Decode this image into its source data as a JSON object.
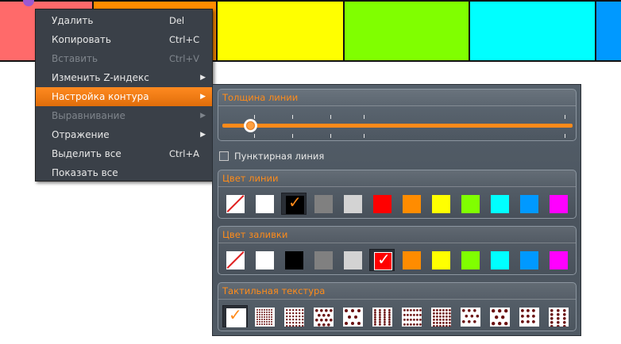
{
  "canvas": {
    "blocks": [
      {
        "color": "#ff6a6a"
      },
      {
        "color": "#ff8c00"
      },
      {
        "color": "#ffff00"
      },
      {
        "color": "#80ff00"
      },
      {
        "color": "#00ffff"
      },
      {
        "color": "#0099ff"
      }
    ]
  },
  "menu": {
    "items": [
      {
        "label": "Удалить",
        "shortcut": "Del",
        "disabled": false,
        "submenu": false
      },
      {
        "label": "Копировать",
        "shortcut": "Ctrl+C",
        "disabled": false,
        "submenu": false
      },
      {
        "label": "Вставить",
        "shortcut": "Ctrl+V",
        "disabled": true,
        "submenu": false
      },
      {
        "label": "Изменить Z-индекс",
        "shortcut": "",
        "disabled": false,
        "submenu": true
      },
      {
        "label": "Настройка контура",
        "shortcut": "",
        "disabled": false,
        "submenu": true,
        "highlighted": true
      },
      {
        "label": "Выравнивание",
        "shortcut": "",
        "disabled": true,
        "submenu": true
      },
      {
        "label": "Отражение",
        "shortcut": "",
        "disabled": false,
        "submenu": true
      },
      {
        "label": "Выделить все",
        "shortcut": "Ctrl+A",
        "disabled": false,
        "submenu": false
      },
      {
        "label": "Показать все",
        "shortcut": "",
        "disabled": false,
        "submenu": false
      }
    ],
    "submenu_arrow": "▶"
  },
  "panel": {
    "line_width": {
      "title": "Толщина линии",
      "value_fraction": 0.08
    },
    "dashed": {
      "label": "Пунктирная линия",
      "checked": false
    },
    "line_color": {
      "title": "Цвет линии",
      "selected_index": 2,
      "colors": [
        "none",
        "#ffffff",
        "#000000",
        "#808080",
        "#d3d3d3",
        "#ff0000",
        "#ff8c00",
        "#ffff00",
        "#80ff00",
        "#00ffff",
        "#0099ff",
        "#ff00ff"
      ]
    },
    "fill_color": {
      "title": "Цвет заливки",
      "selected_index": 5,
      "colors": [
        "none",
        "#ffffff",
        "#000000",
        "#808080",
        "#d3d3d3",
        "#ff0000",
        "#ff8c00",
        "#ffff00",
        "#80ff00",
        "#00ffff",
        "#0099ff",
        "#ff00ff"
      ]
    },
    "texture": {
      "title": "Тактильная текстура",
      "selected_index": 0,
      "patterns": [
        "none",
        "dense-grid",
        "dots-grid",
        "dots-diagonal",
        "dots-sparse",
        "dots-columns",
        "dots-rows",
        "dots-fine",
        "dots-scattered",
        "dots-big",
        "dots-medium",
        "dots-pairs"
      ]
    },
    "check_glyph": "✓"
  }
}
